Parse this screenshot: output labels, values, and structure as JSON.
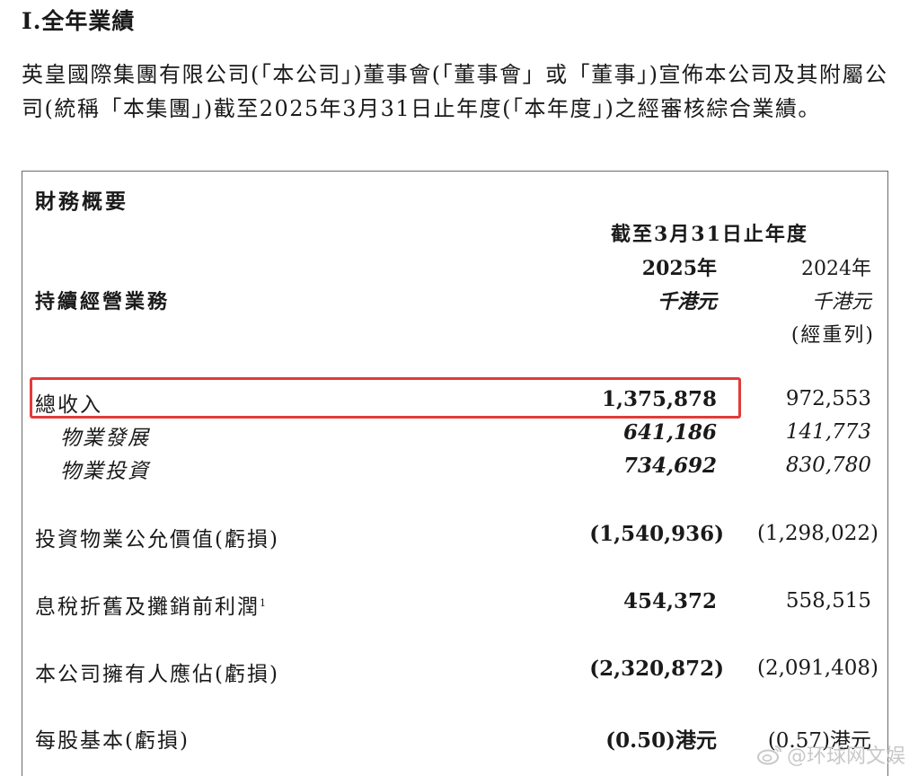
{
  "section": {
    "title": "I.全年業績"
  },
  "intro": {
    "text": "英皇國際集團有限公司(「本公司」)董事會(「董事會」或「董事」)宣佈本公司及其附屬公司(統稱「本集團」)截至2025年3月31日止年度(「本年度」)之經審核綜合業績。"
  },
  "summary": {
    "title": "財務概要",
    "period_header": "截至3月31日止年度",
    "segment_heading": "持續經營業務",
    "columns": [
      {
        "year": "2025年",
        "unit": "千港元",
        "note": ""
      },
      {
        "year": "2024年",
        "unit": "千港元",
        "note": "(經重列)"
      }
    ],
    "rows": [
      {
        "label": "總收入",
        "current": "1,375,878",
        "previous": "972,553",
        "highlighted": true
      },
      {
        "label": "物業發展",
        "current": "641,186",
        "previous": "141,773",
        "sub": true
      },
      {
        "label": "物業投資",
        "current": "734,692",
        "previous": "830,780",
        "sub": true
      },
      {
        "label": "投資物業公允價值(虧損)",
        "current": "(1,540,936)",
        "previous": "(1,298,022)"
      },
      {
        "label": "息稅折舊及攤銷前利潤",
        "footnote": "1",
        "current": "454,372",
        "previous": "558,515"
      },
      {
        "label": "本公司擁有人應佔(虧損)",
        "current": "(2,320,872)",
        "previous": "(2,091,408)"
      },
      {
        "label": "每股基本(虧損)",
        "current": "(0.50)港元",
        "previous": "(0.57)港元"
      }
    ]
  },
  "watermark": {
    "text": "@环球网文娱"
  },
  "colors": {
    "highlight": "#e23a3a",
    "border": "#6a6a6a",
    "text": "#1a1a1a"
  }
}
